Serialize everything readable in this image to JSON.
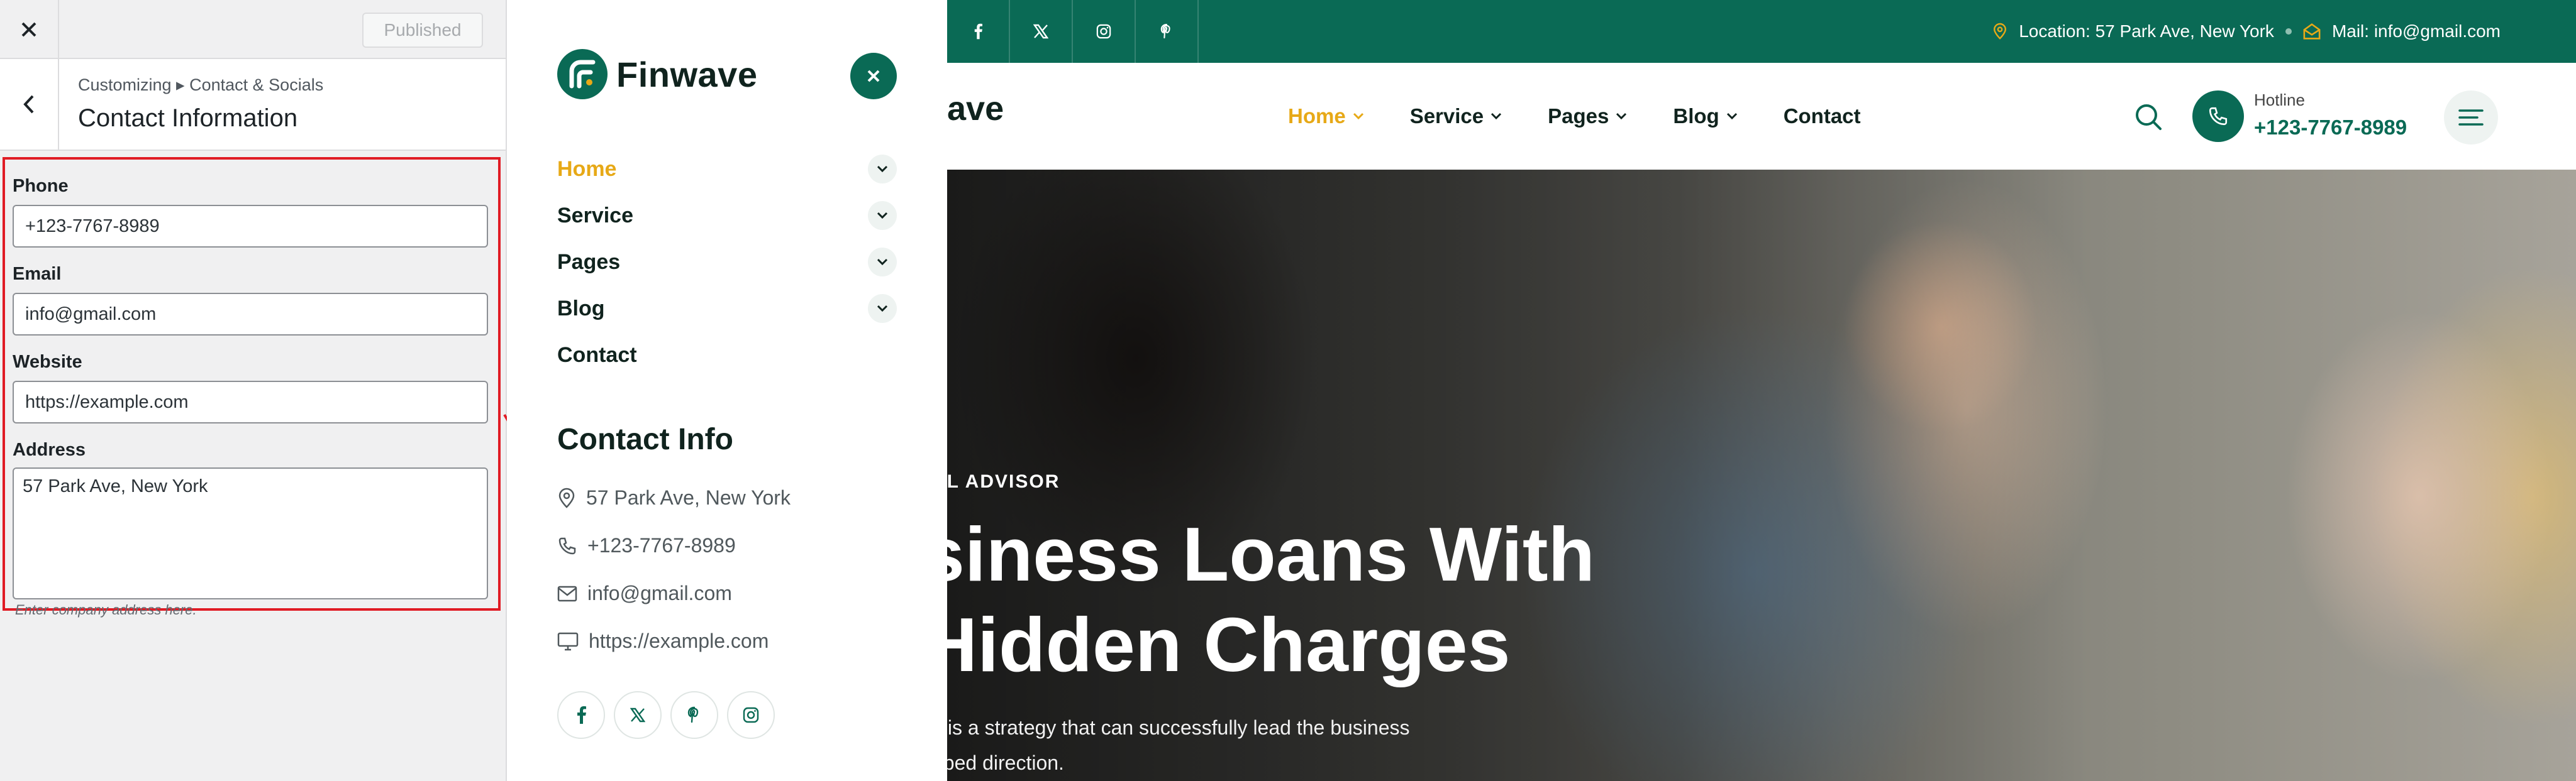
{
  "customizer": {
    "published_label": "Published",
    "breadcrumb": "Customizing ▸ Contact & Socials",
    "section_title": "Contact Information",
    "fields": {
      "phone": {
        "label": "Phone",
        "value": "+123-7767-8989"
      },
      "email": {
        "label": "Email",
        "value": "info@gmail.com"
      },
      "website": {
        "label": "Website",
        "value": "https://example.com"
      },
      "address": {
        "label": "Address",
        "value": "57 Park Ave, New York",
        "description": "Enter company address here."
      }
    }
  },
  "offcanvas": {
    "logo_text": "Finwave",
    "menu": [
      {
        "label": "Home",
        "active": true,
        "has_submenu": true
      },
      {
        "label": "Service",
        "active": false,
        "has_submenu": true
      },
      {
        "label": "Pages",
        "active": false,
        "has_submenu": true
      },
      {
        "label": "Blog",
        "active": false,
        "has_submenu": true
      },
      {
        "label": "Contact",
        "active": false,
        "has_submenu": false
      }
    ],
    "contact_heading": "Contact Info",
    "contact": {
      "address": "57 Park Ave, New York",
      "phone": "+123-7767-8989",
      "email": "info@gmail.com",
      "website": "https://example.com"
    },
    "socials": [
      "facebook-icon",
      "x-icon",
      "pinterest-icon",
      "instagram-icon"
    ]
  },
  "site": {
    "topbar": {
      "socials": [
        "facebook-icon",
        "x-icon",
        "instagram-icon",
        "pinterest-icon"
      ],
      "location": "Location: 57 Park Ave, New York",
      "mail": "Mail: info@gmail.com"
    },
    "header": {
      "logo_text": "ave",
      "nav": [
        {
          "label": "Home",
          "active": true,
          "has_submenu": true
        },
        {
          "label": "Service",
          "active": false,
          "has_submenu": true
        },
        {
          "label": "Pages",
          "active": false,
          "has_submenu": true
        },
        {
          "label": "Blog",
          "active": false,
          "has_submenu": true
        },
        {
          "label": "Contact",
          "active": false,
          "has_submenu": false
        }
      ],
      "hotline_label": "Hotline",
      "hotline_number": "+123-7767-8989"
    },
    "hero": {
      "tagline": "AL ADVISOR",
      "heading_line1": "siness Loans With",
      "heading_line2": "Hidden Charges",
      "text_line1": "y is a strategy that can successfully lead the business",
      "text_line2": "oped direction."
    }
  },
  "colors": {
    "brand_green": "#0a6a55",
    "accent_gold": "#e7a917",
    "highlight_red": "#e01b24"
  }
}
